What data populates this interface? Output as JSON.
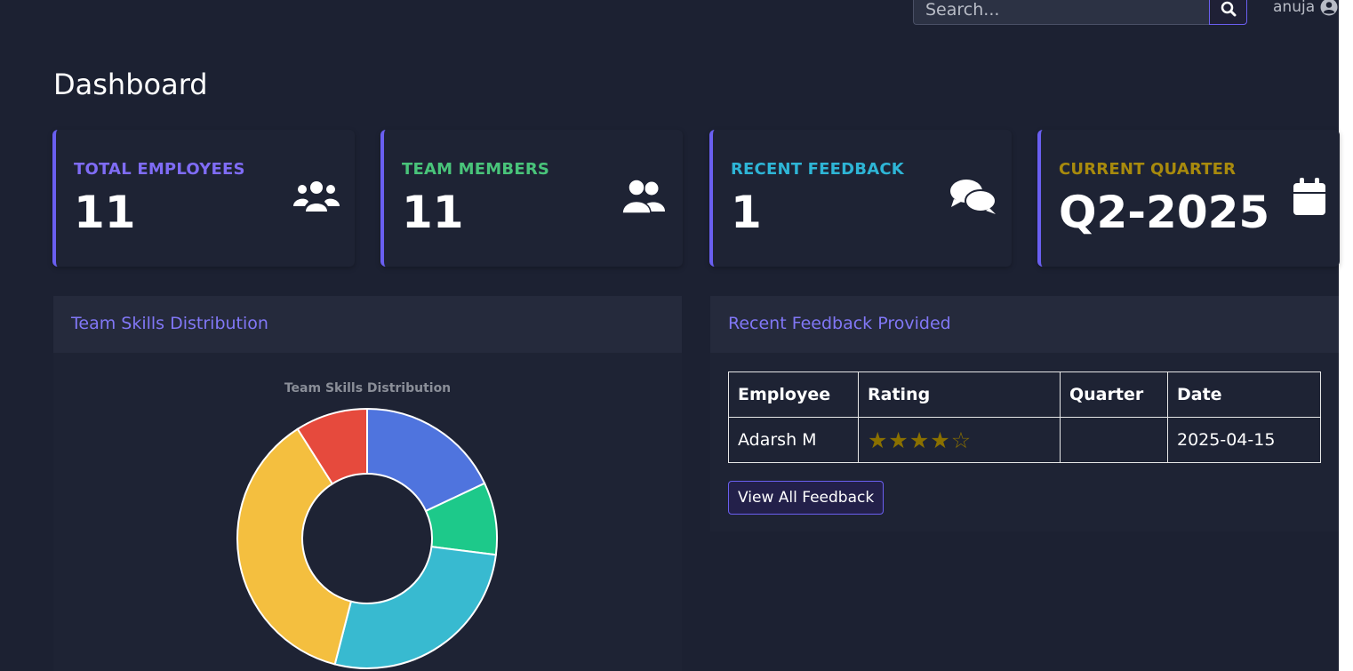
{
  "search": {
    "placeholder": "Search..."
  },
  "user": {
    "name": "anuja"
  },
  "page": {
    "title": "Dashboard"
  },
  "cards": [
    {
      "label": "TOTAL EMPLOYEES",
      "value": "11",
      "color": "#7f6cf6",
      "icon": "users-icon"
    },
    {
      "label": "TEAM MEMBERS",
      "value": "11",
      "color": "#49c47a",
      "icon": "user-friends-icon"
    },
    {
      "label": "RECENT FEEDBACK",
      "value": "1",
      "color": "#2eb5d6",
      "icon": "comments-icon"
    },
    {
      "label": "CURRENT QUARTER",
      "value": "Q2-2025",
      "color": "#a88a0d",
      "icon": "calendar-icon"
    }
  ],
  "skills_panel": {
    "title": "Team Skills Distribution"
  },
  "chart_data": {
    "type": "pie",
    "title": "Team Skills Distribution",
    "labels": [],
    "values": [
      18,
      9,
      27,
      37,
      9
    ],
    "colors": [
      "#4f74de",
      "#1dc98a",
      "#38bad0",
      "#f4bf3f",
      "#e64a3d"
    ]
  },
  "feedback_panel": {
    "title": "Recent Feedback Provided",
    "columns": [
      "Employee",
      "Rating",
      "Quarter",
      "Date"
    ],
    "rows": [
      {
        "employee": "Adarsh M",
        "rating": 4,
        "max_rating": 5,
        "quarter": "",
        "date": "2025-04-15"
      }
    ],
    "view_all_label": "View All Feedback"
  }
}
